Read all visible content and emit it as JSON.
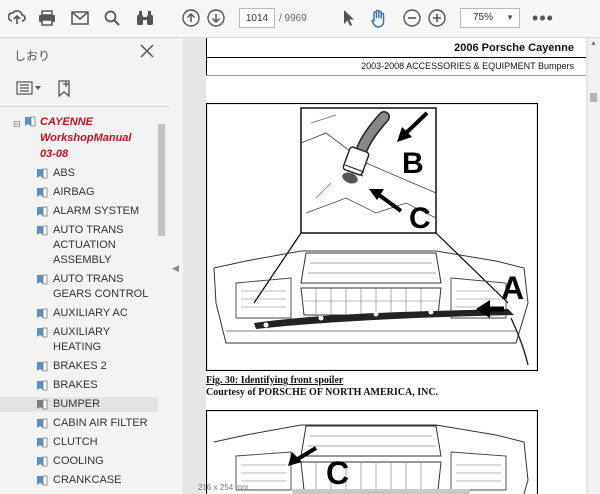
{
  "toolbar": {
    "page_current": "1014",
    "page_total": "/ 9969",
    "zoom": "75%",
    "icons": [
      "upload-icon",
      "print-icon",
      "mail-icon",
      "search-icon",
      "binoculars-icon",
      "page-up-icon",
      "page-down-icon",
      "pointer-icon",
      "hand-icon",
      "zoom-out-icon",
      "zoom-in-icon",
      "more-icon"
    ]
  },
  "sidebar": {
    "title": "しおり",
    "root": {
      "label_line1": "CAYENNE",
      "label_line2": "WorkshopManual",
      "label_line3": "03-08"
    },
    "items": [
      {
        "label": "ABS"
      },
      {
        "label": "AIRBAG"
      },
      {
        "label": "ALARM SYSTEM"
      },
      {
        "label": "AUTO TRANS ACTUATION ASSEMBLY"
      },
      {
        "label": "AUTO TRANS GEARS CONTROL"
      },
      {
        "label": "AUXILIARY AC"
      },
      {
        "label": "AUXILIARY HEATING"
      },
      {
        "label": "BRAKES 2"
      },
      {
        "label": "BRAKES"
      },
      {
        "label": "BUMPER"
      },
      {
        "label": "CABIN AIR FILTER"
      },
      {
        "label": "CLUTCH"
      },
      {
        "label": "COOLING"
      },
      {
        "label": "CRANKCASE"
      }
    ],
    "selected": "BUMPER"
  },
  "document": {
    "header_title": "2006 Porsche Cayenne",
    "header_subtitle": "2003-2008 ACCESSORIES & EQUIPMENT Bumpers",
    "figure1": {
      "label_a": "A",
      "label_b": "B",
      "label_c": "C"
    },
    "figure2": {
      "label_c": "C"
    },
    "caption": "Fig. 30: Identifying front spoiler",
    "credit": "Courtesy of PORSCHE OF NORTH AMERICA, INC.",
    "page_size": "216 x 254 mm"
  }
}
